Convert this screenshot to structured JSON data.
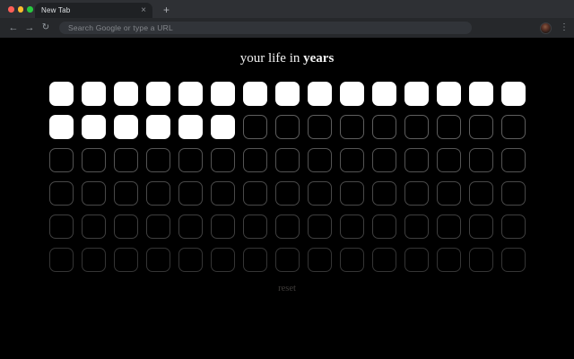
{
  "browser": {
    "window_controls": {
      "close_color": "#ff5f57",
      "minimize_color": "#febc2e",
      "zoom_color": "#28c840"
    },
    "tab": {
      "title": "New Tab",
      "close_icon": "×"
    },
    "new_tab_icon": "+",
    "toolbar": {
      "back_icon": "←",
      "forward_icon": "→",
      "reload_icon": "↻",
      "omnibox_placeholder": "Search Google or type a URL",
      "menu_icon": "⋮"
    }
  },
  "page": {
    "title_regular": "your life in ",
    "title_bold": "years",
    "reset_label": "reset",
    "grid": {
      "columns": 15,
      "rows": 6,
      "total_cells": 90,
      "filled_cells": 21,
      "filled_color": "#ffffff",
      "empty_border_color": "#4a4a4a",
      "background_color": "#000000"
    }
  }
}
